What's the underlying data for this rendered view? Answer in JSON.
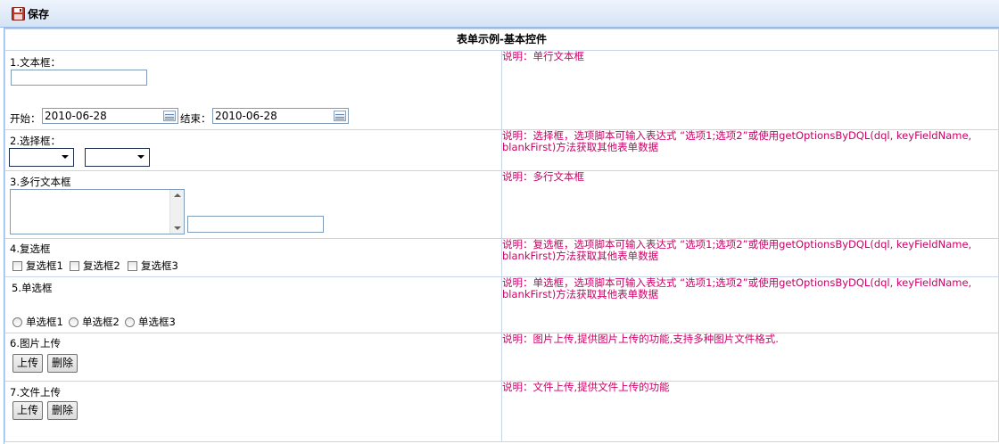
{
  "toolbar": {
    "save_label": "保存",
    "save_icon": "floppy-disk-icon"
  },
  "form": {
    "title": "表单示例-基本控件",
    "rows": [
      {
        "label": "1.文本框：",
        "description": "说明：单行文本框",
        "text_value": "",
        "start_label": "开始：",
        "start_date": "2010-06-28",
        "end_label": "结束：",
        "end_date": "2010-06-28"
      },
      {
        "label": "2.选择框：",
        "description": "说明：选择框，选项脚本可输入表达式 “选项1;选项2”或使用getOptionsByDQL(dql, keyFieldName, blankFirst)方法获取其他表单数据",
        "select1_value": "",
        "select2_value": ""
      },
      {
        "label": "3.多行文本框",
        "description": "说明：多行文本框",
        "textarea_value": "",
        "text_value": ""
      },
      {
        "label": "4.复选框",
        "description": "说明：复选框，选项脚本可输入表达式 “选项1;选项2”或使用getOptionsByDQL(dql, keyFieldName, blankFirst)方法获取其他表单数据",
        "options": [
          "复选框1",
          "复选框2",
          "复选框3"
        ]
      },
      {
        "label": "5.单选框",
        "description": "说明：单选框，选项脚本可输入表达式 “选项1;选项2”或使用getOptionsByDQL(dql, keyFieldName, blankFirst)方法获取其他表单数据",
        "options": [
          "单选框1",
          "单选框2",
          "单选框3"
        ]
      },
      {
        "label": "6.图片上传",
        "description": "说明：图片上传,提供图片上传的功能,支持多种图片文件格式.",
        "upload_label": "上传",
        "delete_label": "删除"
      },
      {
        "label": "7.文件上传",
        "description": "说明：文件上传,提供文件上传的功能",
        "upload_label": "上传",
        "delete_label": "删除"
      }
    ]
  },
  "colors": {
    "description": "#cc0066",
    "border": "#c6d5e8",
    "toolbar_border": "#99bbe8"
  }
}
